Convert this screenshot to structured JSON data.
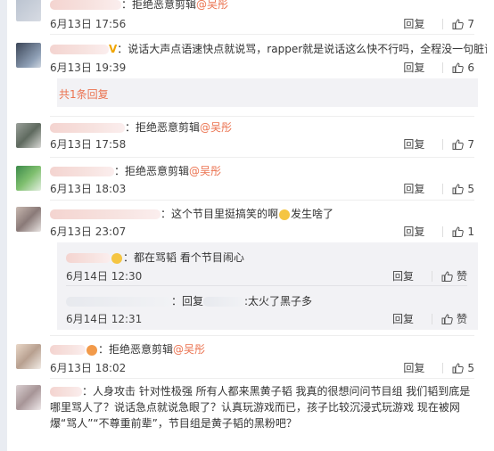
{
  "comments": [
    {
      "text": "：拒绝恶意剪辑",
      "mention": "@吴彤",
      "date": "6月13日 17:56",
      "reply": "回复",
      "likes": "7"
    },
    {
      "text": "：说话大声点语速快点就说骂，rapper就是说话这么快不行吗，全程没一句脏话。",
      "date": "6月13日 19:39",
      "reply": "回复",
      "likes": "6"
    },
    {
      "text": "：拒绝恶意剪辑",
      "mention": "@吴彤",
      "date": "6月13日 17:58",
      "reply": "回复",
      "likes": "7"
    },
    {
      "text": "：拒绝恶意剪辑",
      "mention": "@吴彤",
      "date": "6月13日 18:03",
      "reply": "回复",
      "likes": "5"
    },
    {
      "text": "：这个节目里挺搞笑的啊",
      "text2": "发生啥了",
      "date": "6月13日 23:07",
      "reply": "回复",
      "likes": "1"
    },
    {
      "text": "：拒绝恶意剪辑",
      "mention": "@吴彤",
      "date": "6月13日 18:02",
      "reply": "回复",
      "likes": "5"
    },
    {
      "text": "：人身攻击 针对性极强 所有人都来黑黄子韬 我真的很想问问节目组 我们韬到底是哪里骂人了？说话急点就说急眼了？认真玩游戏而已，孩子比较沉浸式玩游戏 现在被网爆“骂人”“不尊重前辈”，节目组是黄子韬的黑粉吧？"
    }
  ],
  "more_replies": "共1条回复",
  "sub_replies": [
    {
      "text": "：都在骂韬 看个节目闹心",
      "date": "6月14日 12:30",
      "reply": "回复",
      "likes": "赞"
    },
    {
      "prefix": "：回复",
      "text": ":太火了黑子多",
      "date": "6月14日 12:31",
      "reply": "回复",
      "likes": "赞"
    }
  ]
}
